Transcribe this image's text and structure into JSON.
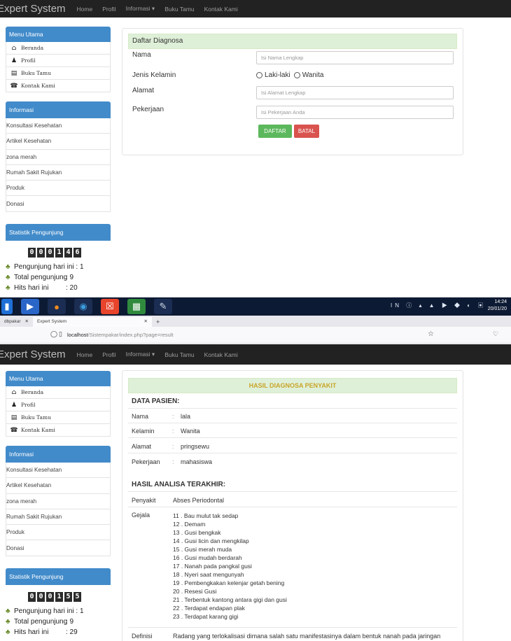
{
  "navbar": {
    "brand": "Expert System",
    "items": [
      "Home",
      "Profil",
      "Informasi ▾",
      "Buku Tamu",
      "Kontak Kami"
    ]
  },
  "sidebar": {
    "menu_title": "Menu Utama",
    "menu_items": [
      "Beranda",
      "Profil",
      "Buku Tamu",
      "Kontak Kami"
    ],
    "info_title": "Informasi",
    "info_items": [
      "Konsultasi Kesehatan",
      "Artikel Kesehatan",
      "zona merah",
      "Rumah Sakit Rujukan",
      "Produk",
      "Donasi"
    ],
    "stats_title": "Statistik Pengunjung"
  },
  "stats1": {
    "digits": [
      "0",
      "0",
      "0",
      "1",
      "4",
      "6"
    ],
    "rows": [
      {
        "label": "Pengunjung hari ini",
        "value": ": 1"
      },
      {
        "label": "Total pengunjung",
        "value": ": 9"
      },
      {
        "label": "Hits hari ini",
        "value": ": 20"
      }
    ]
  },
  "stats2": {
    "digits": [
      "0",
      "0",
      "0",
      "1",
      "5",
      "5"
    ],
    "rows": [
      {
        "label": "Pengunjung hari ini",
        "value": ": 1"
      },
      {
        "label": "Total pengunjung",
        "value": ": 9"
      },
      {
        "label": "Hits hari ini",
        "value": ": 29"
      }
    ]
  },
  "form": {
    "title": "Daftar Diagnosa",
    "nama_label": "Nama",
    "nama_placeholder": "Isi Nama Lengkap",
    "jk_label": "Jenis Kelamin",
    "jk_opt1": "Laki-laki",
    "jk_opt2": "Wanita",
    "alamat_label": "Alamat",
    "alamat_placeholder": "Isi Alamat Lengkap",
    "pekerjaan_label": "Pekerjaan",
    "pekerjaan_placeholder": "Isi Pekerjaan Anda",
    "submit": "DAFTAR",
    "cancel": "BATAL"
  },
  "taskbar": {
    "time": "14:24",
    "date": "20/01/20"
  },
  "browser": {
    "tab_prev": "dbpakar",
    "tab_active": "Expert System",
    "url_host": "localhost",
    "url_path": "/Sistempakar/index.php?page=result"
  },
  "result": {
    "title": "HASIL DIAGNOSA PENYAKIT",
    "patient_title": "DATA PASIEN:",
    "patient": [
      {
        "label": "Nama",
        "value": "lala"
      },
      {
        "label": "Kelamin",
        "value": "Wanita"
      },
      {
        "label": "Alamat",
        "value": "pringsewu"
      },
      {
        "label": "Pekerjaan",
        "value": "mahasiswa"
      }
    ],
    "analysis_title": "HASIL ANALISA TERAKHIR:",
    "penyakit_label": "Penyakit",
    "penyakit_value": "Abses Periodontal",
    "gejala_label": "Gejala",
    "gejala": [
      "11 . Bau mulut tak sedap",
      "12 . Demam",
      "13 . Gusi bengkak",
      "14 . Gusi licin dan mengkilap",
      "15 . Gusi merah muda",
      "16 . Gusi mudah berdarah",
      "17 . Nanah pada pangkal gusi",
      "18 . Nyeri saat mengunyah",
      "19 . Pembengkakan kelenjar getah bening",
      "20 . Resesi Gusi",
      "21 . Terbentuk kantong antara gigi dan gusi",
      "22 . Terdapat endapan plak",
      "23 . Terdapat karang gigi"
    ],
    "definisi_label": "Definisi",
    "definisi_value": "Radang yang terlokalisasi dimana salah satu manifestasinya dalam bentuk nanah pada jaringan"
  }
}
